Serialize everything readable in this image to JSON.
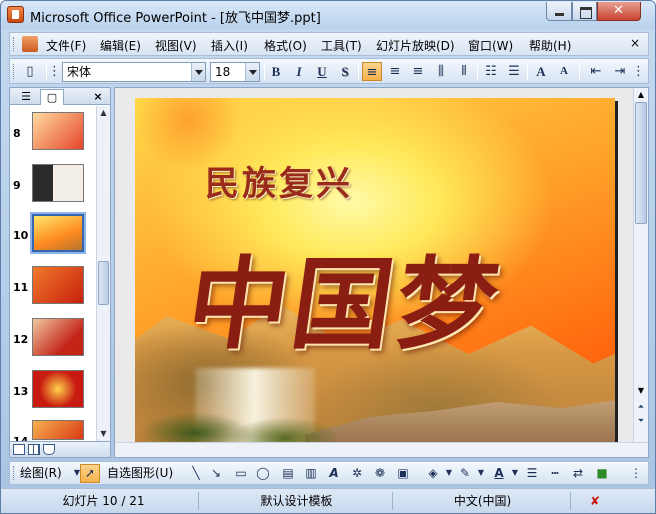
{
  "window": {
    "title": "Microsoft Office PowerPoint - [放飞中国梦.ppt]"
  },
  "menu": {
    "items": [
      "文件(F)",
      "编辑(E)",
      "视图(V)",
      "插入(I)",
      "格式(O)",
      "工具(T)",
      "幻灯片放映(D)",
      "窗口(W)",
      "帮助(H)"
    ],
    "close_glyph": "×"
  },
  "toolbar": {
    "font_name": "宋体",
    "font_size": "18",
    "bold": "B",
    "italic": "I",
    "underline": "U",
    "shadow": "S",
    "grow_font": "A",
    "shrink_font": "A"
  },
  "slides_pane": {
    "close_glyph": "×",
    "thumbnails": [
      {
        "number": "8"
      },
      {
        "number": "9"
      },
      {
        "number": "10",
        "selected": true
      },
      {
        "number": "11"
      },
      {
        "number": "12"
      },
      {
        "number": "13"
      },
      {
        "number": "14"
      }
    ]
  },
  "slide": {
    "subtitle": "民族复兴",
    "title": "中国梦"
  },
  "drawing_toolbar": {
    "draw_label": "绘图(R)",
    "autoshapes_label": "自选图形(U)"
  },
  "status": {
    "slide_info": "幻灯片 10 / 21",
    "design": "默认设计模板",
    "language": "中文(中国)"
  },
  "colors": {
    "accent": "#3566b0",
    "chrome": "#d6e3f3",
    "slide_title": "#8a1e12"
  }
}
